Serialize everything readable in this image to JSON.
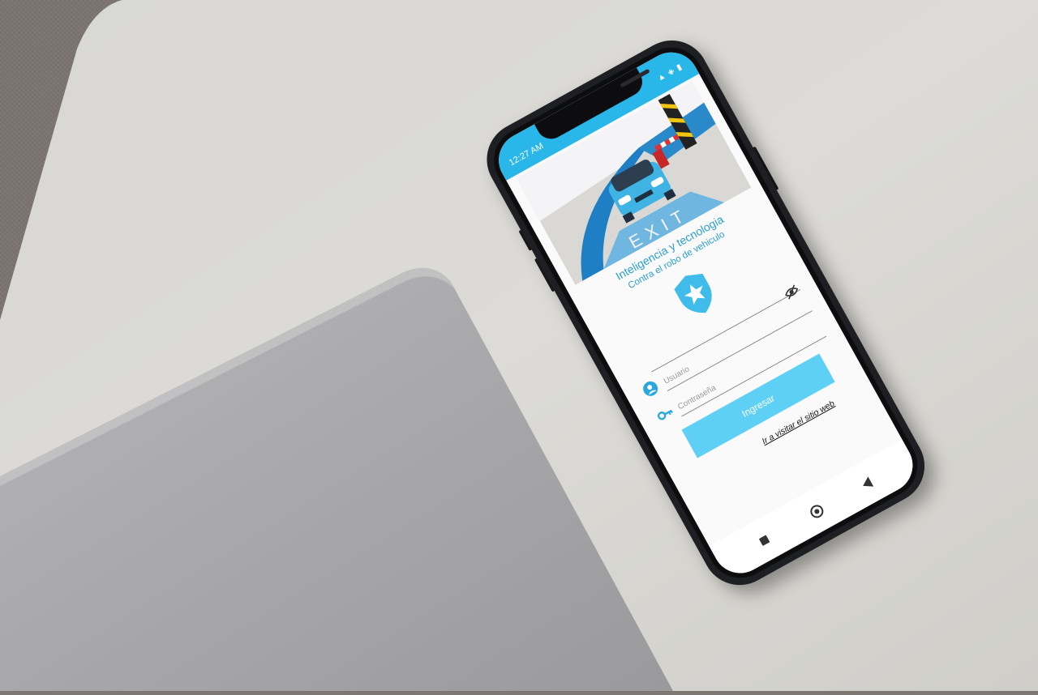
{
  "status_bar": {
    "time": "12:27 AM",
    "icons": "▲ ◈ ▮"
  },
  "app": {
    "title": "Inteligencia y tecnologia",
    "subtitle": "Contra el robo de vehiculo",
    "hero_sign_text": "EXIT",
    "username_placeholder": "Usuario",
    "password_placeholder": "Contraseña",
    "login_button": "Ingresar",
    "website_link": "Ir a visitar el sitio web"
  },
  "colors": {
    "primary": "#29b6e8",
    "button": "#5fd0f5",
    "shield": "#3fbce9",
    "title_text": "#2a9fd0"
  },
  "icons": {
    "user": "user-circle-icon",
    "key": "key-icon",
    "eye": "eye-off-icon",
    "shield": "shield-star-icon"
  }
}
